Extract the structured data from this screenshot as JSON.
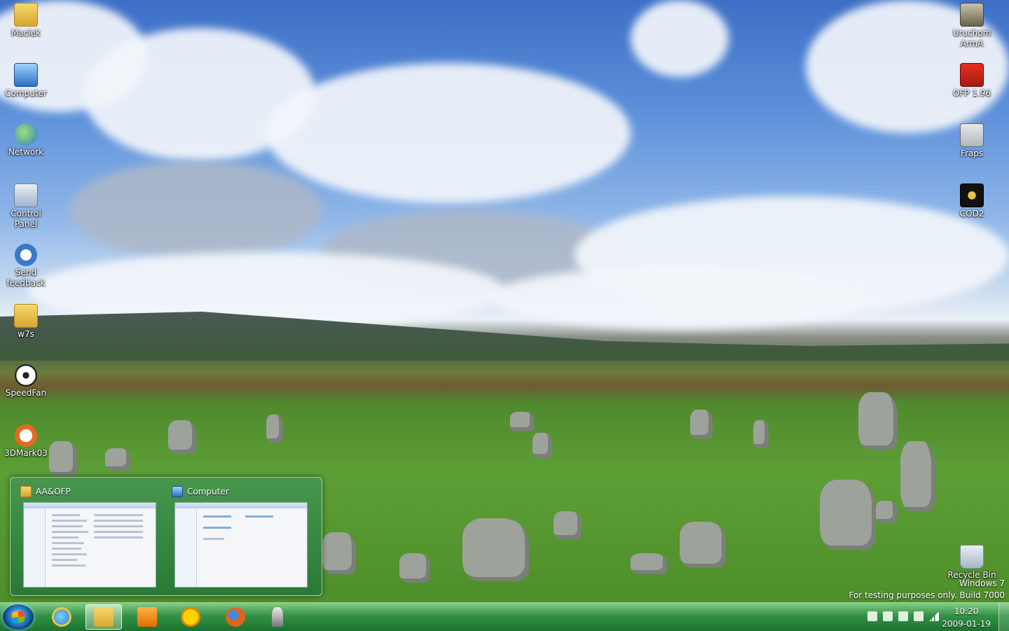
{
  "desktop": {
    "left_icons": [
      {
        "label": "Maciek",
        "icon": "user-folder-icon"
      },
      {
        "label": "Computer",
        "icon": "computer-icon"
      },
      {
        "label": "Network",
        "icon": "network-icon"
      },
      {
        "label": "Control Panel",
        "icon": "control-panel-icon"
      },
      {
        "label": "Send feedback",
        "icon": "send-feedback-icon"
      },
      {
        "label": "w7s",
        "icon": "folder-icon"
      },
      {
        "label": "SpeedFan",
        "icon": "speedfan-icon"
      },
      {
        "label": "3DMark03",
        "icon": "3dmark-icon"
      }
    ],
    "right_icons": [
      {
        "label": "Uruchom ArmA",
        "icon": "arma-icon"
      },
      {
        "label": "OFP 1.96",
        "icon": "ofp-icon"
      },
      {
        "label": "Fraps",
        "icon": "fraps-icon"
      },
      {
        "label": "COD2",
        "icon": "cod2-icon"
      },
      {
        "label": "Recycle Bin",
        "icon": "recycle-bin-icon"
      }
    ],
    "watermark": {
      "line1": "Windows 7",
      "line2": "For testing purposes only. Build 7000"
    }
  },
  "thumbnail_popup": {
    "windows": [
      {
        "title": "AA&OFP",
        "icon": "folder-icon"
      },
      {
        "title": "Computer",
        "icon": "computer-icon"
      }
    ]
  },
  "taskbar": {
    "pinned": [
      {
        "name": "start-button",
        "icon": "windows-logo-icon"
      },
      {
        "name": "internet-explorer",
        "icon": "internet-explorer-icon"
      },
      {
        "name": "windows-explorer",
        "icon": "folder-explorer-icon",
        "active": true
      },
      {
        "name": "media-player",
        "icon": "media-player-icon"
      },
      {
        "name": "smiley-app",
        "icon": "smiley-icon"
      },
      {
        "name": "firefox",
        "icon": "firefox-icon"
      },
      {
        "name": "chess",
        "icon": "chess-pawn-icon"
      }
    ],
    "clock": {
      "time": "10:20",
      "date": "2009-01-19"
    }
  }
}
